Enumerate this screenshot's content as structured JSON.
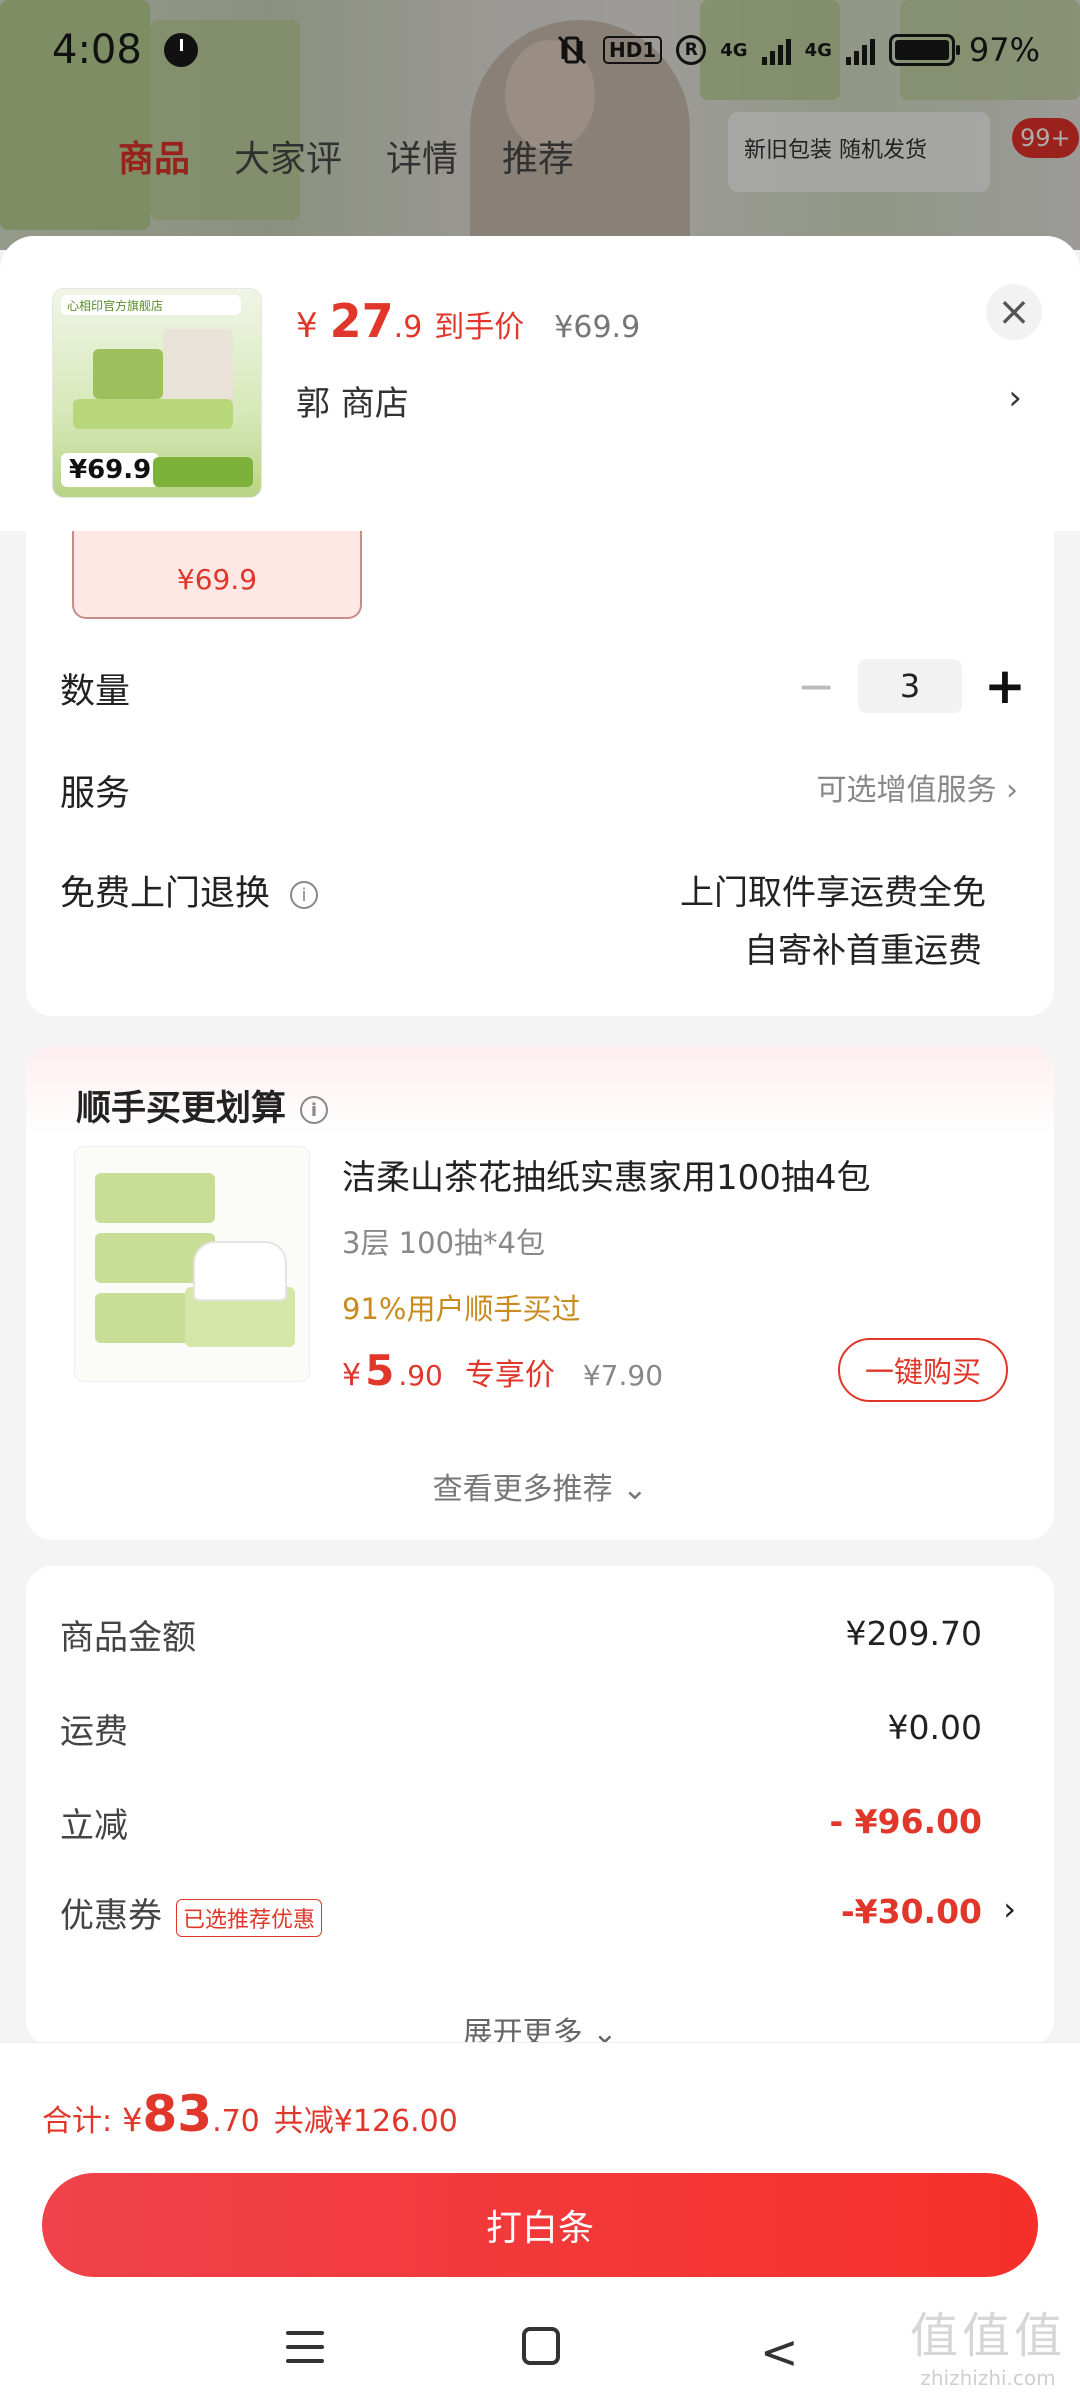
{
  "status_bar": {
    "time": "4:08",
    "hd_label": "HD1",
    "r_label": "R",
    "net1": "4G",
    "net2": "4G",
    "battery": "97%"
  },
  "background": {
    "tabs": [
      "商品",
      "大家评",
      "详情",
      "推荐"
    ],
    "card_title": "新旧包装 随机发货",
    "badge": "99+"
  },
  "header": {
    "price_yen": "¥",
    "price_int": "27",
    "price_dec": ".9",
    "price_tag": "到手价",
    "price_orig": "¥69.9",
    "shop_name": "郭  商店",
    "arrow": "›",
    "close": "×",
    "thumb_price": "¥69.9",
    "thumb_store": "心相印官方旗舰店"
  },
  "options": {
    "sku_price": "¥69.9",
    "qty_label": "数量",
    "qty_minus": "−",
    "qty_value": "3",
    "qty_plus": "+",
    "service_label": "服务",
    "service_value": "可选增值服务 ›",
    "return_label": "免费上门退换",
    "info": "i",
    "return_line1": "上门取件享运费全免",
    "return_line2": "自寄补首重运费"
  },
  "recommend": {
    "title": "顺手买更划算",
    "info": "i",
    "name": "洁柔山茶花抽纸实惠家用100抽4包",
    "spec": "3层 100抽*4包",
    "hint": "91%用户顺手买过",
    "price_yen": "¥",
    "price_int": "5",
    "price_dec": ".90",
    "price_tag": "专享价",
    "price_orig": "¥7.90",
    "buy_label": "一键购买",
    "more": "查看更多推荐 ⌄"
  },
  "summary": {
    "rows": [
      {
        "label": "商品金额",
        "value": "¥209.70"
      },
      {
        "label": "运费",
        "value": "¥0.00"
      },
      {
        "label": "立减",
        "value": "- ¥96.00"
      },
      {
        "label": "优惠券",
        "value": "-¥30.00",
        "badge": "已选推荐优惠",
        "arrow": "›"
      }
    ],
    "expand": "展开更多 ⌄"
  },
  "bottom": {
    "total_label": "合计:",
    "total_yen": "¥",
    "total_int": "83",
    "total_dec": ".70",
    "total_save": "共减¥126.00",
    "pay_label": "打白条",
    "nav_back": "<"
  },
  "watermark": {
    "main": "值值值",
    "url": "zhizhizhi.com"
  },
  "colors": {
    "accent": "#e0372a",
    "hint": "#c98a1e",
    "button": "#f5302a"
  }
}
